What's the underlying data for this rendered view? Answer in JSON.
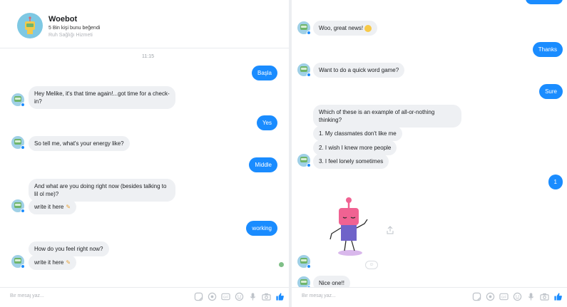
{
  "left": {
    "header": {
      "name": "Woebot",
      "likes": "5 Bin kişi bunu beğendi",
      "category": "Ruh Sağlığı Hizmeti"
    },
    "timestamp": "11:15",
    "messages": [
      {
        "from": "user",
        "text": "Başla"
      },
      {
        "from": "bot",
        "text": "Hey Melike, it's that time again!...got time for a check-in?"
      },
      {
        "from": "user",
        "text": "Yes"
      },
      {
        "from": "bot",
        "text": "So tell me, what's your energy like?"
      },
      {
        "from": "user",
        "text": "Middle"
      },
      {
        "from": "bot",
        "text": "And what are you doing right now (besides talking to lil ol me)?"
      },
      {
        "from": "bot",
        "text": "write it here"
      },
      {
        "from": "user",
        "text": "working"
      },
      {
        "from": "bot",
        "text": "How do you feel right now?"
      },
      {
        "from": "bot",
        "text": "write it here"
      }
    ],
    "composer_placeholder": "Bir mesaj yaz..."
  },
  "right": {
    "messages": [
      {
        "from": "bot",
        "text": "Woo, great news!"
      },
      {
        "from": "user",
        "text": "Thanks"
      },
      {
        "from": "bot",
        "text": "Want to do a quick word game?"
      },
      {
        "from": "user",
        "text": "Sure"
      },
      {
        "from": "bot",
        "text": "Which of these is an example of all-or-nothing thinking?"
      },
      {
        "from": "bot",
        "text": "1. My classmates don't like me"
      },
      {
        "from": "bot",
        "text": "2. I wish I knew more people"
      },
      {
        "from": "bot",
        "text": "3. I feel lonely sometimes"
      },
      {
        "from": "user",
        "text": "1"
      },
      {
        "from": "bot",
        "text": "Nice one!!"
      }
    ],
    "composer_placeholder": "Bir mesaj yaz..."
  },
  "composer_icons": [
    "sticker-icon",
    "gif-search-icon",
    "gif-icon",
    "emoji-icon",
    "microphone-icon",
    "camera-icon",
    "thumbs-up-icon"
  ],
  "colors": {
    "accent": "#1a8cff",
    "bot_bubble": "#eef0f3",
    "divider": "#eceef1"
  }
}
